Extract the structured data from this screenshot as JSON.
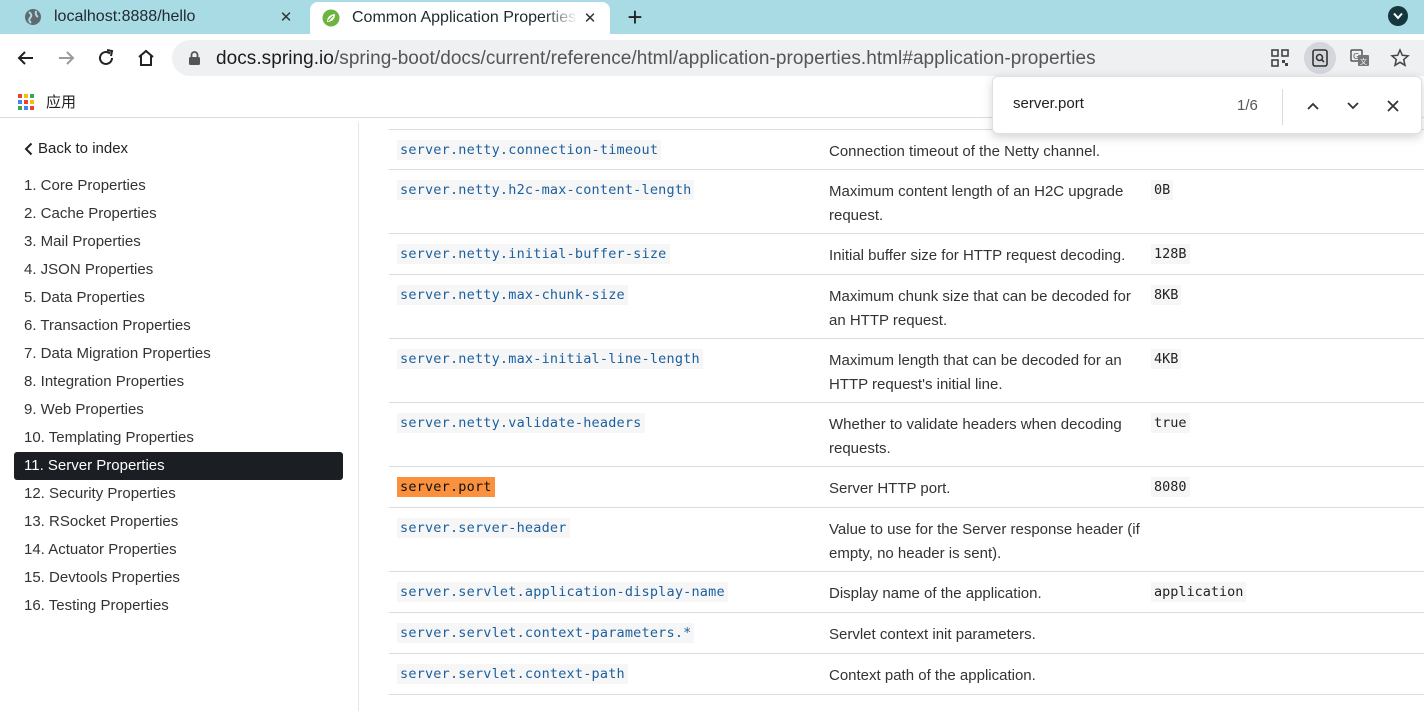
{
  "browser": {
    "tabs": [
      {
        "title": "localhost:8888/hello",
        "icon": "globe-icon",
        "active": false
      },
      {
        "title": "Common Application Properties",
        "icon": "spring-leaf-icon",
        "active": true
      }
    ],
    "url_host": "docs.spring.io",
    "url_path": "/spring-boot/docs/current/reference/html/application-properties.html#application-properties",
    "bookmarks": {
      "apps_label": "应用"
    },
    "colors": {
      "tab_strip": "#a9dbe4",
      "omnibox": "#eef0f2"
    }
  },
  "find": {
    "query": "server.port",
    "count": "1/6"
  },
  "sidebar": {
    "back_label": "Back to index",
    "items": [
      "1. Core Properties",
      "2. Cache Properties",
      "3. Mail Properties",
      "4. JSON Properties",
      "5. Data Properties",
      "6. Transaction Properties",
      "7. Data Migration Properties",
      "8. Integration Properties",
      "9. Web Properties",
      "10. Templating Properties",
      "11. Server Properties",
      "12. Security Properties",
      "13. RSocket Properties",
      "14. Actuator Properties",
      "15. Devtools Properties",
      "16. Testing Properties"
    ],
    "active_index": 10
  },
  "properties": [
    {
      "key": "server.netty.connection-timeout",
      "desc": "Connection timeout of the Netty channel.",
      "default": ""
    },
    {
      "key": "server.netty.h2c-max-content-length",
      "desc": "Maximum content length of an H2C upgrade request.",
      "default": "0B"
    },
    {
      "key": "server.netty.initial-buffer-size",
      "desc": "Initial buffer size for HTTP request decoding.",
      "default": "128B"
    },
    {
      "key": "server.netty.max-chunk-size",
      "desc": "Maximum chunk size that can be decoded for an HTTP request.",
      "default": "8KB"
    },
    {
      "key": "server.netty.max-initial-line-length",
      "desc": "Maximum length that can be decoded for an HTTP request's initial line.",
      "default": "4KB"
    },
    {
      "key": "server.netty.validate-headers",
      "desc": "Whether to validate headers when decoding requests.",
      "default": "true"
    },
    {
      "key": "server.port",
      "desc": "Server HTTP port.",
      "default": "8080",
      "highlight": true
    },
    {
      "key": "server.server-header",
      "desc": "Value to use for the Server response header (if empty, no header is sent).",
      "default": ""
    },
    {
      "key": "server.servlet.application-display-name",
      "desc": "Display name of the application.",
      "default": "application"
    },
    {
      "key": "server.servlet.context-parameters.*",
      "desc": "Servlet context init parameters.",
      "default": ""
    },
    {
      "key": "server.servlet.context-path",
      "desc": "Context path of the application.",
      "default": ""
    }
  ]
}
